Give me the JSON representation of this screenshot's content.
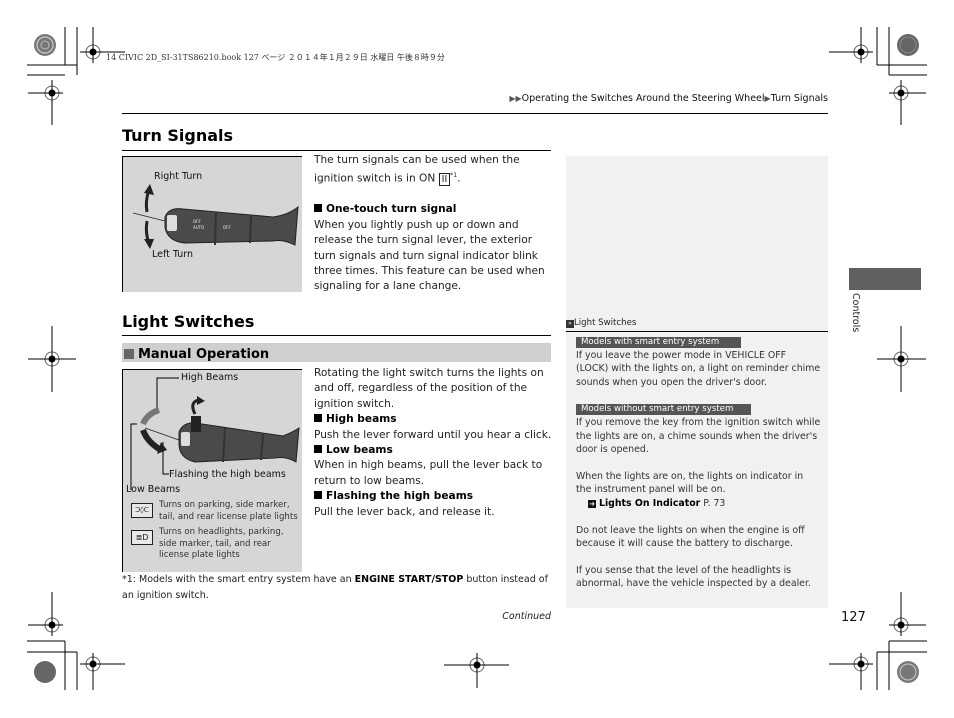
{
  "print_header": {
    "file_line": "14 CIVIC 2D_SI-31TS86210.book  127 ページ  ２０１４年１月２９日  水曜日  午後８時９分"
  },
  "breadcrumb": {
    "items": [
      "Operating the Switches Around the Steering Wheel",
      "Turn Signals"
    ]
  },
  "turn_signals": {
    "title": "Turn Signals",
    "figure": {
      "label_right": "Right Turn",
      "label_left": "Left Turn"
    },
    "intro": "The turn signals can be used when the ignition switch is in ON",
    "intro_symbol": "II",
    "intro_footnote": "*1",
    "intro_end": ".",
    "subsections": [
      {
        "heading": "One-touch turn signal",
        "text": "When you lightly push up or down and release the turn signal lever, the exterior turn signals and turn signal indicator blink three times. This feature can be used when signaling for a lane change."
      }
    ]
  },
  "light_switches": {
    "title": "Light Switches",
    "manual_operation": "Manual Operation",
    "figure": {
      "label_high": "High Beams",
      "label_flash": "Flashing the high beams",
      "label_low": "Low Beams",
      "legend": [
        {
          "icon": "parking-lights-icon",
          "text": "Turns on parking, side marker, tail, and rear license plate lights"
        },
        {
          "icon": "headlights-icon",
          "text": "Turns on headlights, parking, side marker, tail, and rear license plate lights"
        }
      ]
    },
    "intro": "Rotating the light switch turns the lights on and off, regardless of the position of the ignition switch.",
    "subsections": [
      {
        "heading": "High beams",
        "text": "Push the lever forward until you hear a click."
      },
      {
        "heading": "Low beams",
        "text": "When in high beams, pull the lever back to return to low beams."
      },
      {
        "heading": "Flashing the high beams",
        "text": "Pull the lever back, and release it."
      }
    ]
  },
  "footnote": {
    "prefix": "*1: Models with the smart entry system have an ",
    "bold": "ENGINE START/STOP",
    "suffix": " button instead of an ignition switch."
  },
  "continued": "Continued",
  "sidebar": {
    "heading": "Light Switches",
    "badge_with": "Models with smart entry system",
    "text_with": "If you leave the power mode in VEHICLE OFF (LOCK) with the lights on, a light on reminder chime sounds when you open the driver's door.",
    "badge_without": "Models without smart entry system",
    "text_without": "If you remove the key from the ignition switch while the lights are on, a chime sounds when the driver's door is opened.",
    "text_indicator": "When the lights are on, the lights on indicator in the instrument panel will be on.",
    "link_label": "Lights On Indicator",
    "link_page": "P. 73",
    "text_battery": "Do not leave the lights on when the engine is off because it will cause the battery to discharge.",
    "text_dealer": "If you sense that the level of the headlights is abnormal, have the vehicle inspected by a dealer."
  },
  "side_tab": {
    "label": "Controls"
  },
  "page_number": "127"
}
